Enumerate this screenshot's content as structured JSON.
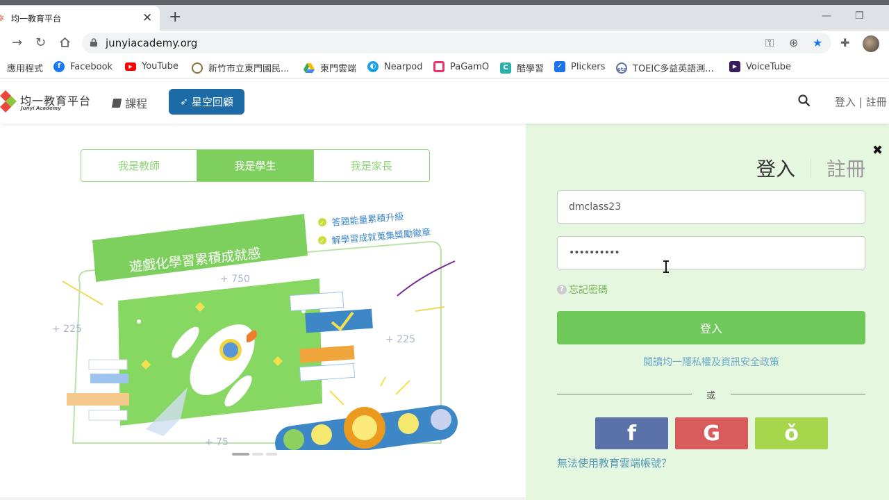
{
  "browser": {
    "tab_title": "均一教育平台",
    "url": "junyiacademy.org",
    "bookmarks": [
      {
        "label": "應用程式",
        "color": "#4285f4"
      },
      {
        "label": "Facebook",
        "color": "#1877f2"
      },
      {
        "label": "YouTube",
        "color": "#ff0000"
      },
      {
        "label": "新竹市立東門國民...",
        "color": "#8a6d3b"
      },
      {
        "label": "東門雲端",
        "color": "#34a853"
      },
      {
        "label": "Nearpod",
        "color": "#1aa1e6"
      },
      {
        "label": "PaGamO",
        "color": "#e8346b"
      },
      {
        "label": "酷學習",
        "color": "#2ab0a8"
      },
      {
        "label": "Plickers",
        "color": "#1a73e8"
      },
      {
        "label": "TOEIC多益英語測...",
        "color": "#5a6fa8"
      },
      {
        "label": "VoiceTube",
        "color": "#3a1d5e"
      }
    ]
  },
  "header": {
    "logo_text": "均一教育平台",
    "logo_sub": "Junyi Academy",
    "course_label": "課程",
    "star_button": "星空回顧",
    "auth_links": "登入 | 註冊"
  },
  "left": {
    "role_tabs": [
      "我是教師",
      "我是學生",
      "我是家長"
    ],
    "active_role": 1,
    "hero": {
      "banner": "遊戲化學習累積成就感",
      "bullet1": "答題能量累積升級",
      "bullet2": "解學習成就蒐集獎勵徽章",
      "points": [
        "+ 750",
        "+ 225",
        "+ 225",
        "+ 75"
      ]
    }
  },
  "login": {
    "title_login": "登入",
    "title_register": "註冊",
    "username_value": "dmclass23",
    "password_value": "••••••••••",
    "forgot": "忘記密碼",
    "login_button": "登入",
    "privacy": "閱讀均一隱私權及資訊安全政策",
    "or": "或",
    "facebook_label": "f",
    "google_label": "G",
    "other_label": "ǒ",
    "cannot": "無法使用教育雲端帳號？"
  },
  "colors": {
    "accent_green": "#6fc95a",
    "star_button_blue": "#1c6aa6",
    "facebook": "#5b72a8",
    "google": "#d95c5c",
    "other": "#a6d64b"
  }
}
